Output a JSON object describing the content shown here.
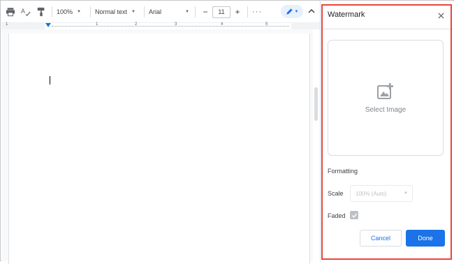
{
  "toolbar": {
    "zoom": "100%",
    "style": "Normal text",
    "font": "Arial",
    "decrease_size": "−",
    "font_size": "11",
    "increase_size": "+",
    "more": "···"
  },
  "ruler": {
    "numbers": [
      "1",
      "1",
      "2",
      "3",
      "4",
      "5"
    ]
  },
  "panel": {
    "title": "Watermark",
    "select_image": "Select Image",
    "formatting": "Formatting",
    "scale_label": "Scale",
    "scale_value": "100% (Auto)",
    "faded_label": "Faded",
    "cancel": "Cancel",
    "done": "Done"
  },
  "colors": {
    "accent": "#1a73e8",
    "highlight_border": "#e8453c"
  }
}
